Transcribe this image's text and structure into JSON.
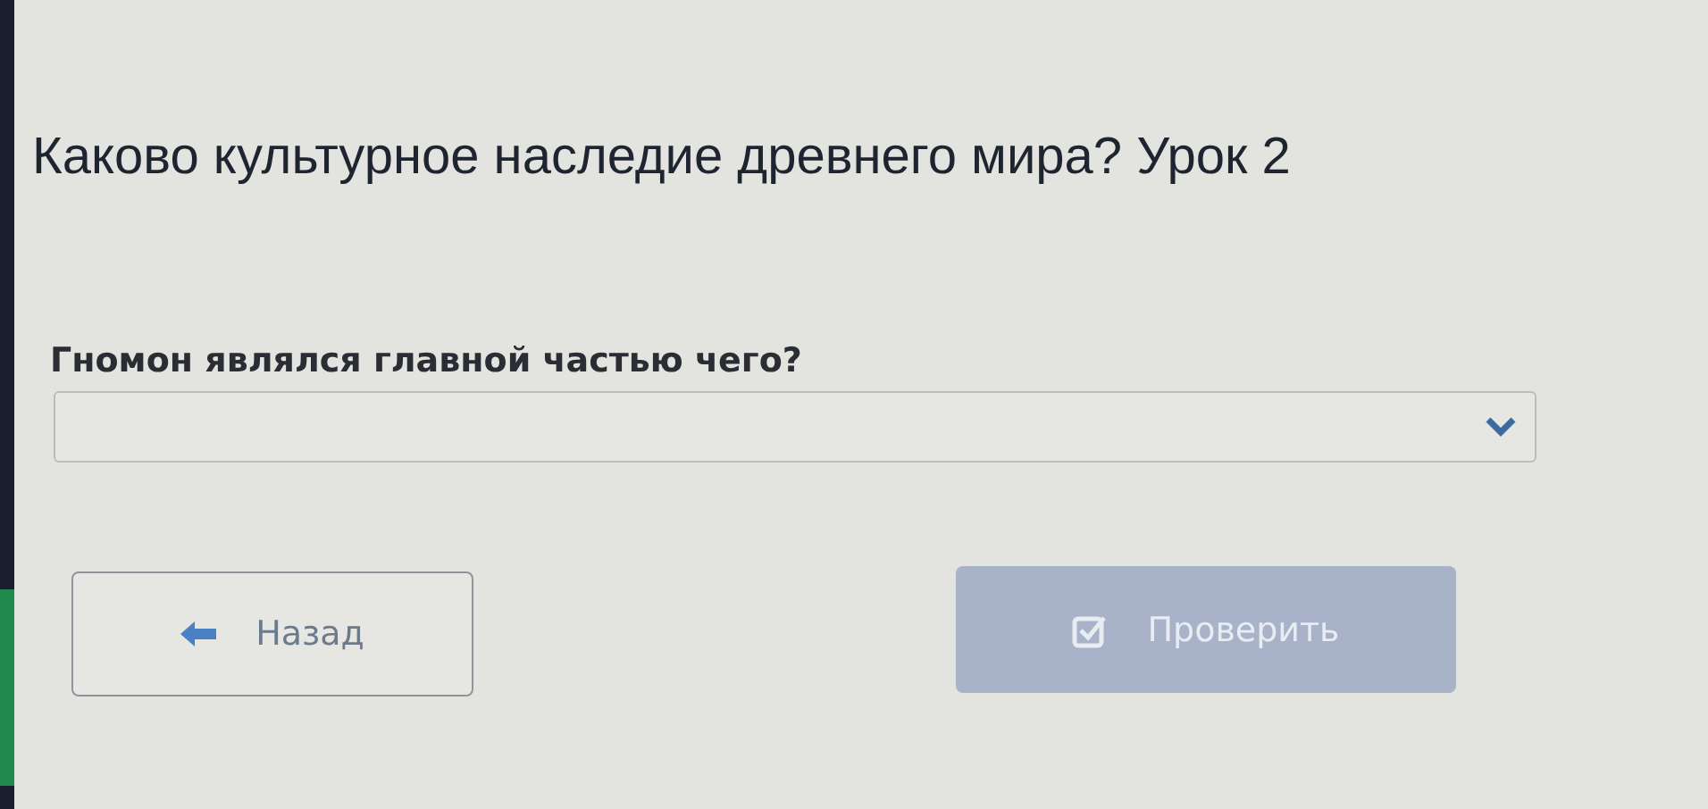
{
  "title": "Каково культурное наследие древнего мира? Урок 2",
  "question": {
    "text": "Гномон являлся главной частью чего?",
    "dropdown": {
      "expanded": false
    }
  },
  "buttons": [
    {
      "kind": "back",
      "label": "Назад",
      "disabled": false
    },
    {
      "kind": "check",
      "label": "Проверить",
      "disabled": true
    }
  ]
}
